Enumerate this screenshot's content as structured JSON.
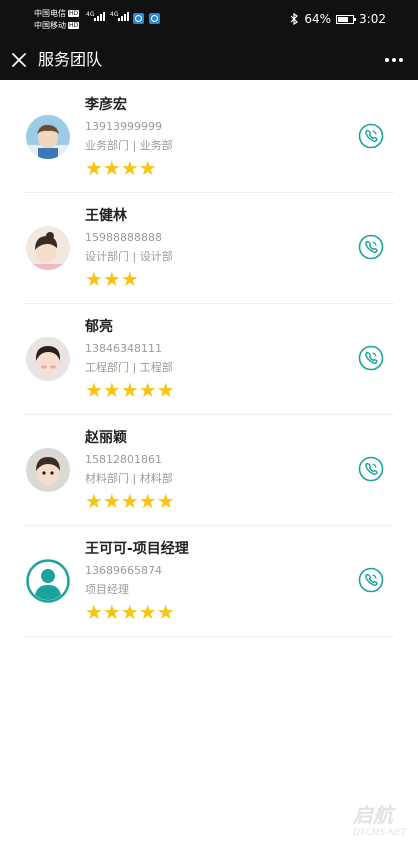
{
  "status_bar": {
    "carrier1": "中国电信",
    "carrier2": "中国移动",
    "hd": "HD",
    "net1": "4G",
    "net2": "4G",
    "battery": "64%",
    "time": "3:02"
  },
  "header": {
    "title": "服务团队",
    "close_icon": "close-icon",
    "more_icon": "more-icon"
  },
  "team": [
    {
      "name": "李彦宏",
      "phone": "13913999999",
      "dept": "业务部门 | 业务部",
      "stars": "★★★★",
      "rating": 4,
      "avatar": "photo-avatar-boy"
    },
    {
      "name": "王健林",
      "phone": "15988888888",
      "dept": "设计部门 | 设计部",
      "stars": "★★★",
      "rating": 3,
      "avatar": "photo-avatar-girl"
    },
    {
      "name": "郁亮",
      "phone": "13846348111",
      "dept": "工程部门 | 工程部",
      "stars": "★★★★★",
      "rating": 5,
      "avatar": "photo-avatar-child"
    },
    {
      "name": "赵丽颖",
      "phone": "15812801861",
      "dept": "材料部门 | 材料部",
      "stars": "★★★★★",
      "rating": 5,
      "avatar": "photo-avatar-child2"
    },
    {
      "name": "王可可-项目经理",
      "phone": "13689665874",
      "dept": "项目经理",
      "stars": "★★★★★",
      "rating": 5,
      "avatar": "default-user-avatar"
    }
  ],
  "colors": {
    "accent": "#1aa39a",
    "star": "#f6c514",
    "header_bg": "#111111"
  },
  "watermark": {
    "main": "启航",
    "sub": "DTCMS.NET"
  }
}
